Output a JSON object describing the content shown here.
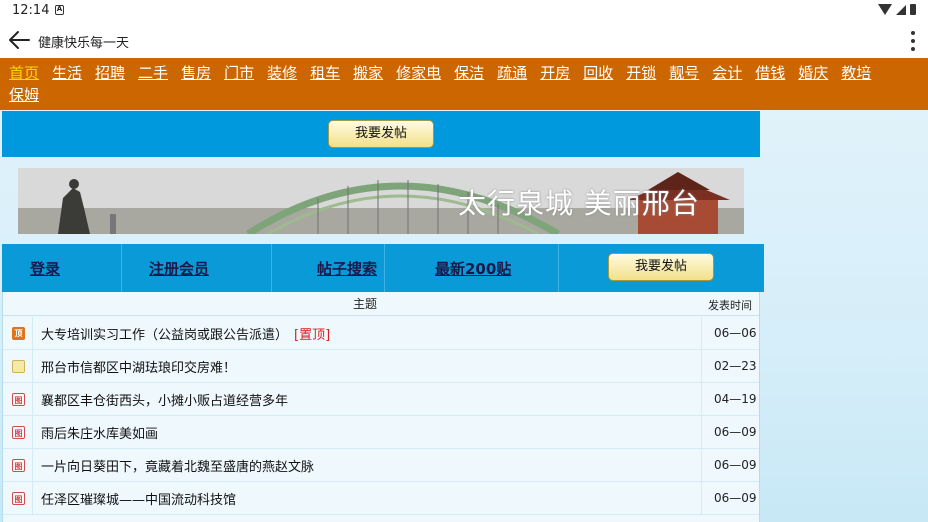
{
  "status_bar": {
    "time": "12:14",
    "notification_letter": "A"
  },
  "app_bar": {
    "title": "健康快乐每一天"
  },
  "nav": {
    "items": [
      "首页",
      "生活",
      "招聘",
      "二手",
      "售房",
      "门市",
      "装修",
      "租车",
      "搬家",
      "修家电",
      "保洁",
      "疏通",
      "开房",
      "回收",
      "开锁",
      "靓号",
      "会计",
      "借钱",
      "婚庆",
      "教培",
      "保姆"
    ]
  },
  "post_button_label": "我要发帖",
  "banner": {
    "slogan": "太行泉城 美丽邢台"
  },
  "member_bar": {
    "login": "登录",
    "register": "注册会员",
    "search": "帖子搜索",
    "latest": "最新200贴"
  },
  "table": {
    "header_subject": "主题",
    "header_time": "发表时间",
    "rows": [
      {
        "icon": "顶",
        "subject": "大专培训实习工作（公益岗或跟公告派遣）",
        "pinned": "[置顶]",
        "time": "06—06"
      },
      {
        "icon": "",
        "subject": "邢台市信都区中湖珐琅印交房难！",
        "pinned": "",
        "time": "02—23"
      },
      {
        "icon": "图",
        "subject": "襄都区丰仓街西头，小摊小贩占道经营多年",
        "pinned": "",
        "time": "04—19"
      },
      {
        "icon": "图",
        "subject": "雨后朱庄水库美如画",
        "pinned": "",
        "time": "06—09"
      },
      {
        "icon": "图",
        "subject": "一片向日葵田下，竟藏着北魏至盛唐的燕赵文脉",
        "pinned": "",
        "time": "06—09"
      },
      {
        "icon": "图",
        "subject": "任泽区璀璨城——中国流动科技馆",
        "pinned": "",
        "time": "06—09"
      }
    ]
  }
}
